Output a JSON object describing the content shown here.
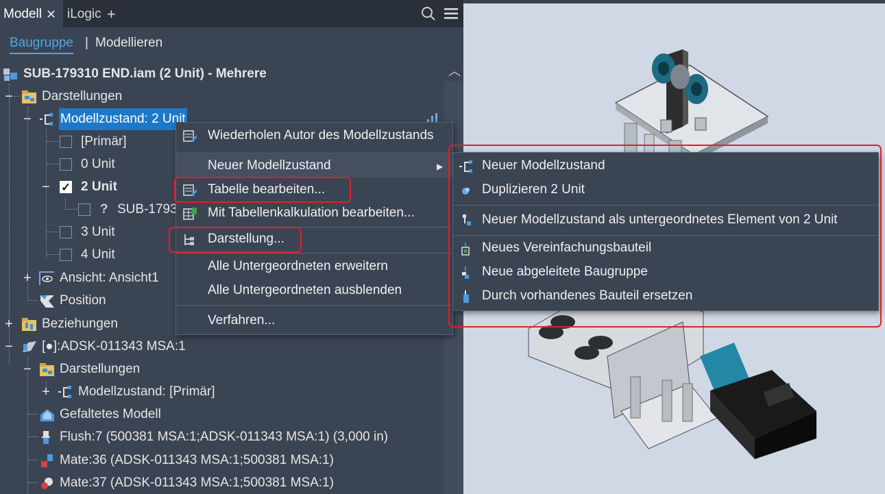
{
  "tabs": [
    {
      "label": "Modell",
      "active": true
    },
    {
      "label": "iLogic",
      "active": false
    }
  ],
  "tab_add": "+",
  "subtabs": {
    "active": "Baugruppe",
    "separator": "|",
    "other": "Modellieren"
  },
  "tree": {
    "root": "SUB-179310 END.iam (2 Unit) - Mehrere",
    "darstellungen": "Darstellungen",
    "modellzustand": "Modellzustand: 2 Unit",
    "primar": "[Primär]",
    "unit0": "0 Unit",
    "unit2": "2 Unit",
    "sub": "SUB-1793",
    "unknown": "?",
    "unit3": "3 Unit",
    "unit4": "4 Unit",
    "ansicht": "Ansicht: Ansicht1",
    "position": "Position",
    "beziehungen": "Beziehungen",
    "adsk": "[●]:ADSK-011343 MSA:1",
    "darstellungen2": "Darstellungen",
    "modellzustand2": "Modellzustand: [Primär]",
    "gefaltetes": "Gefaltetes Modell",
    "flush": "Flush:7 (500381 MSA:1;ADSK-011343 MSA:1) (3,000 in)",
    "mate36": "Mate:36 (ADSK-011343 MSA:1;500381 MSA:1)",
    "mate37": "Mate:37 (ADSK-011343 MSA:1;500381 MSA:1)"
  },
  "context_menu": [
    {
      "label": "Wiederholen Autor des Modellzustands",
      "icon": "table-edit-icon"
    },
    {
      "label": "Neuer Modellzustand",
      "icon": "",
      "submenu": true
    },
    {
      "label": "Tabelle bearbeiten...",
      "icon": "table-edit-icon"
    },
    {
      "label": "Mit Tabellenkalkulation bearbeiten...",
      "icon": "spreadsheet-icon"
    },
    {
      "label": "Darstellung...",
      "icon": "representation-icon"
    },
    {
      "label": "Alle Untergeordneten erweitern",
      "icon": ""
    },
    {
      "label": "Alle Untergeordneten ausblenden",
      "icon": ""
    },
    {
      "label": "Verfahren...",
      "icon": ""
    }
  ],
  "submenu": [
    {
      "label": "Neuer Modellzustand",
      "icon": "model-state-icon"
    },
    {
      "label": "Duplizieren 2 Unit",
      "icon": "duplicate-icon"
    },
    {
      "label": "Neuer Modellzustand als untergeordnetes Element von 2 Unit",
      "icon": "child-state-icon"
    },
    {
      "label": "Neues Vereinfachungsbauteil",
      "icon": "simplify-icon"
    },
    {
      "label": "Neue abgeleitete Baugruppe",
      "icon": "derived-icon"
    },
    {
      "label": "Durch vorhandenes Bauteil ersetzen",
      "icon": "replace-icon"
    }
  ],
  "colors": {
    "highlight_border": "#e21f26",
    "selection": "#1e78c8",
    "accent": "#4ea6e6"
  }
}
